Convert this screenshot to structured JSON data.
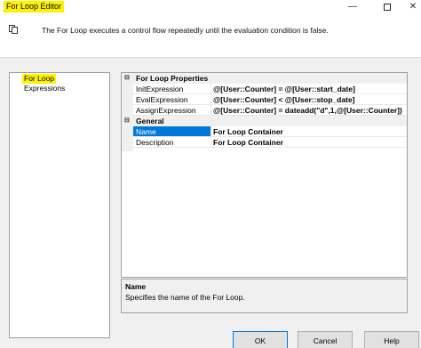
{
  "window": {
    "title": "For Loop Editor",
    "minimize_glyph": "—",
    "close_glyph": "✕"
  },
  "header": {
    "description": "The For Loop executes a control flow repeatedly until the evaluation condition is false."
  },
  "nav": {
    "items": [
      {
        "label": "For Loop",
        "highlighted": true
      },
      {
        "label": "Expressions",
        "highlighted": false
      }
    ]
  },
  "grid": {
    "categories": [
      {
        "label": "For Loop Properties",
        "properties": [
          {
            "name": "InitExpression",
            "value": "@[User::Counter] = @[User::start_date]"
          },
          {
            "name": "EvalExpression",
            "value": "@[User::Counter] < @[User::stop_date]"
          },
          {
            "name": "AssignExpression",
            "value": "@[User::Counter] = dateadd(\"d\",1,@[User::Counter])"
          }
        ]
      },
      {
        "label": "General",
        "properties": [
          {
            "name": "Name",
            "value": "For Loop Container",
            "selected": true
          },
          {
            "name": "Description",
            "value": "For Loop Container"
          }
        ]
      }
    ],
    "toggle_glyph": "⊟"
  },
  "help": {
    "title": "Name",
    "description": "Specifies the name of the For Loop."
  },
  "buttons": {
    "ok": "OK",
    "cancel": "Cancel",
    "help": "Help"
  },
  "colors": {
    "title_highlight": "#fff200",
    "selection": "#0078d7"
  }
}
